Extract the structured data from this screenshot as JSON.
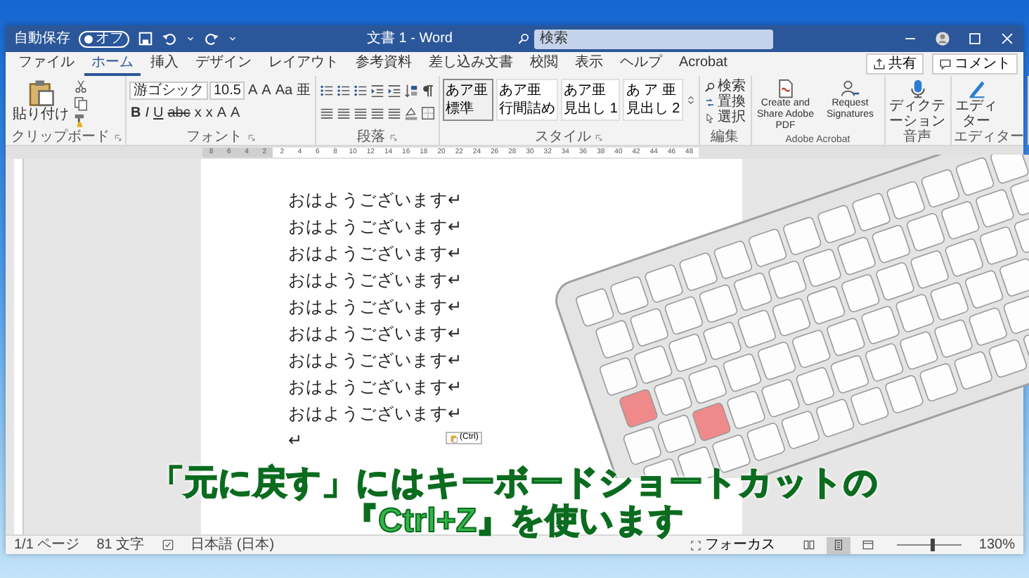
{
  "window": {
    "autosave": "自動保存",
    "autosave_on": false,
    "autosave_state": "オフ",
    "title": "文書 1 - Word",
    "search": {
      "placeholder": "検索"
    }
  },
  "tabs": [
    {
      "label": "ファイル",
      "selected": false
    },
    {
      "label": "ホーム",
      "selected": true
    },
    {
      "label": "挿入",
      "selected": false
    },
    {
      "label": "デザイン",
      "selected": false
    },
    {
      "label": "レイアウト",
      "selected": false
    },
    {
      "label": "参考資料",
      "selected": false
    },
    {
      "label": "差し込み文書",
      "selected": false
    },
    {
      "label": "校閲",
      "selected": false
    },
    {
      "label": "表示",
      "selected": false
    },
    {
      "label": "ヘルプ",
      "selected": false
    },
    {
      "label": "Acrobat",
      "selected": false
    }
  ],
  "share_button": "共有",
  "comment_button": "コメント",
  "ribbon": [
    {
      "kind": "clipboard",
      "label": "クリップボード",
      "paste": "貼り付け"
    },
    {
      "kind": "font",
      "label": "フォント",
      "font_name": "游ゴシック",
      "font_size": "10.5",
      "row_1": [
        "A",
        "A",
        "Aa",
        "亜"
      ],
      "row_2": [
        "B",
        "I",
        "U",
        "abc",
        "x",
        "x",
        "A",
        "A"
      ]
    },
    {
      "kind": "paragraph",
      "label": "段落"
    },
    {
      "kind": "styles",
      "label": "スタイル",
      "styles": [
        {
          "sample": "あア亜",
          "name": "標準",
          "selected": true
        },
        {
          "sample": "あア亜",
          "name": "行間詰め",
          "selected": false
        },
        {
          "sample": "あア亜",
          "name": "見出し 1",
          "selected": false
        },
        {
          "sample": "あ ア 亜",
          "name": "見出し 2",
          "selected": false
        }
      ]
    },
    {
      "kind": "editing",
      "label": "編集",
      "items": [
        "検索",
        "置換",
        "選択"
      ]
    },
    {
      "kind": "acrobat",
      "label": "Adobe Acrobat",
      "items": [
        "Create and Share Adobe PDF",
        "Request Signatures"
      ]
    },
    {
      "kind": "voice",
      "label": "音声",
      "items": [
        "ディクテーション"
      ]
    },
    {
      "kind": "editor",
      "label": "エディター",
      "items": [
        "エディター"
      ]
    }
  ],
  "ruler": {
    "ticks": [
      "8",
      "6",
      "4",
      "2",
      "2",
      "4",
      "6",
      "8",
      "10",
      "12",
      "14",
      "16",
      "18",
      "20",
      "22",
      "24",
      "26",
      "28",
      "30",
      "32",
      "34",
      "36",
      "38",
      "40",
      "42",
      "44",
      "46",
      "48"
    ]
  },
  "document": {
    "lines": [
      "おはようございます↵",
      "おはようございます↵",
      "おはようございます↵",
      "おはようございます↵",
      "おはようございます↵",
      "おはようございます↵",
      "おはようございます↵",
      "おはようございます↵",
      "おはようございます↵",
      "↵"
    ],
    "paste_options": "(Ctrl)"
  },
  "caption": [
    "「元に戻す」にはキーボードショートカットの",
    "『Ctrl+Z』を使います"
  ],
  "status_bar": {
    "page": "1/1 ページ",
    "words": "81 文字",
    "language": "日本語 (日本)",
    "focus": "フォーカス",
    "views": [
      {
        "kind": "read",
        "selected": false
      },
      {
        "kind": "print",
        "selected": true
      },
      {
        "kind": "web",
        "selected": false
      }
    ],
    "zoom": {
      "level": 0.55,
      "reading": "130%"
    }
  }
}
